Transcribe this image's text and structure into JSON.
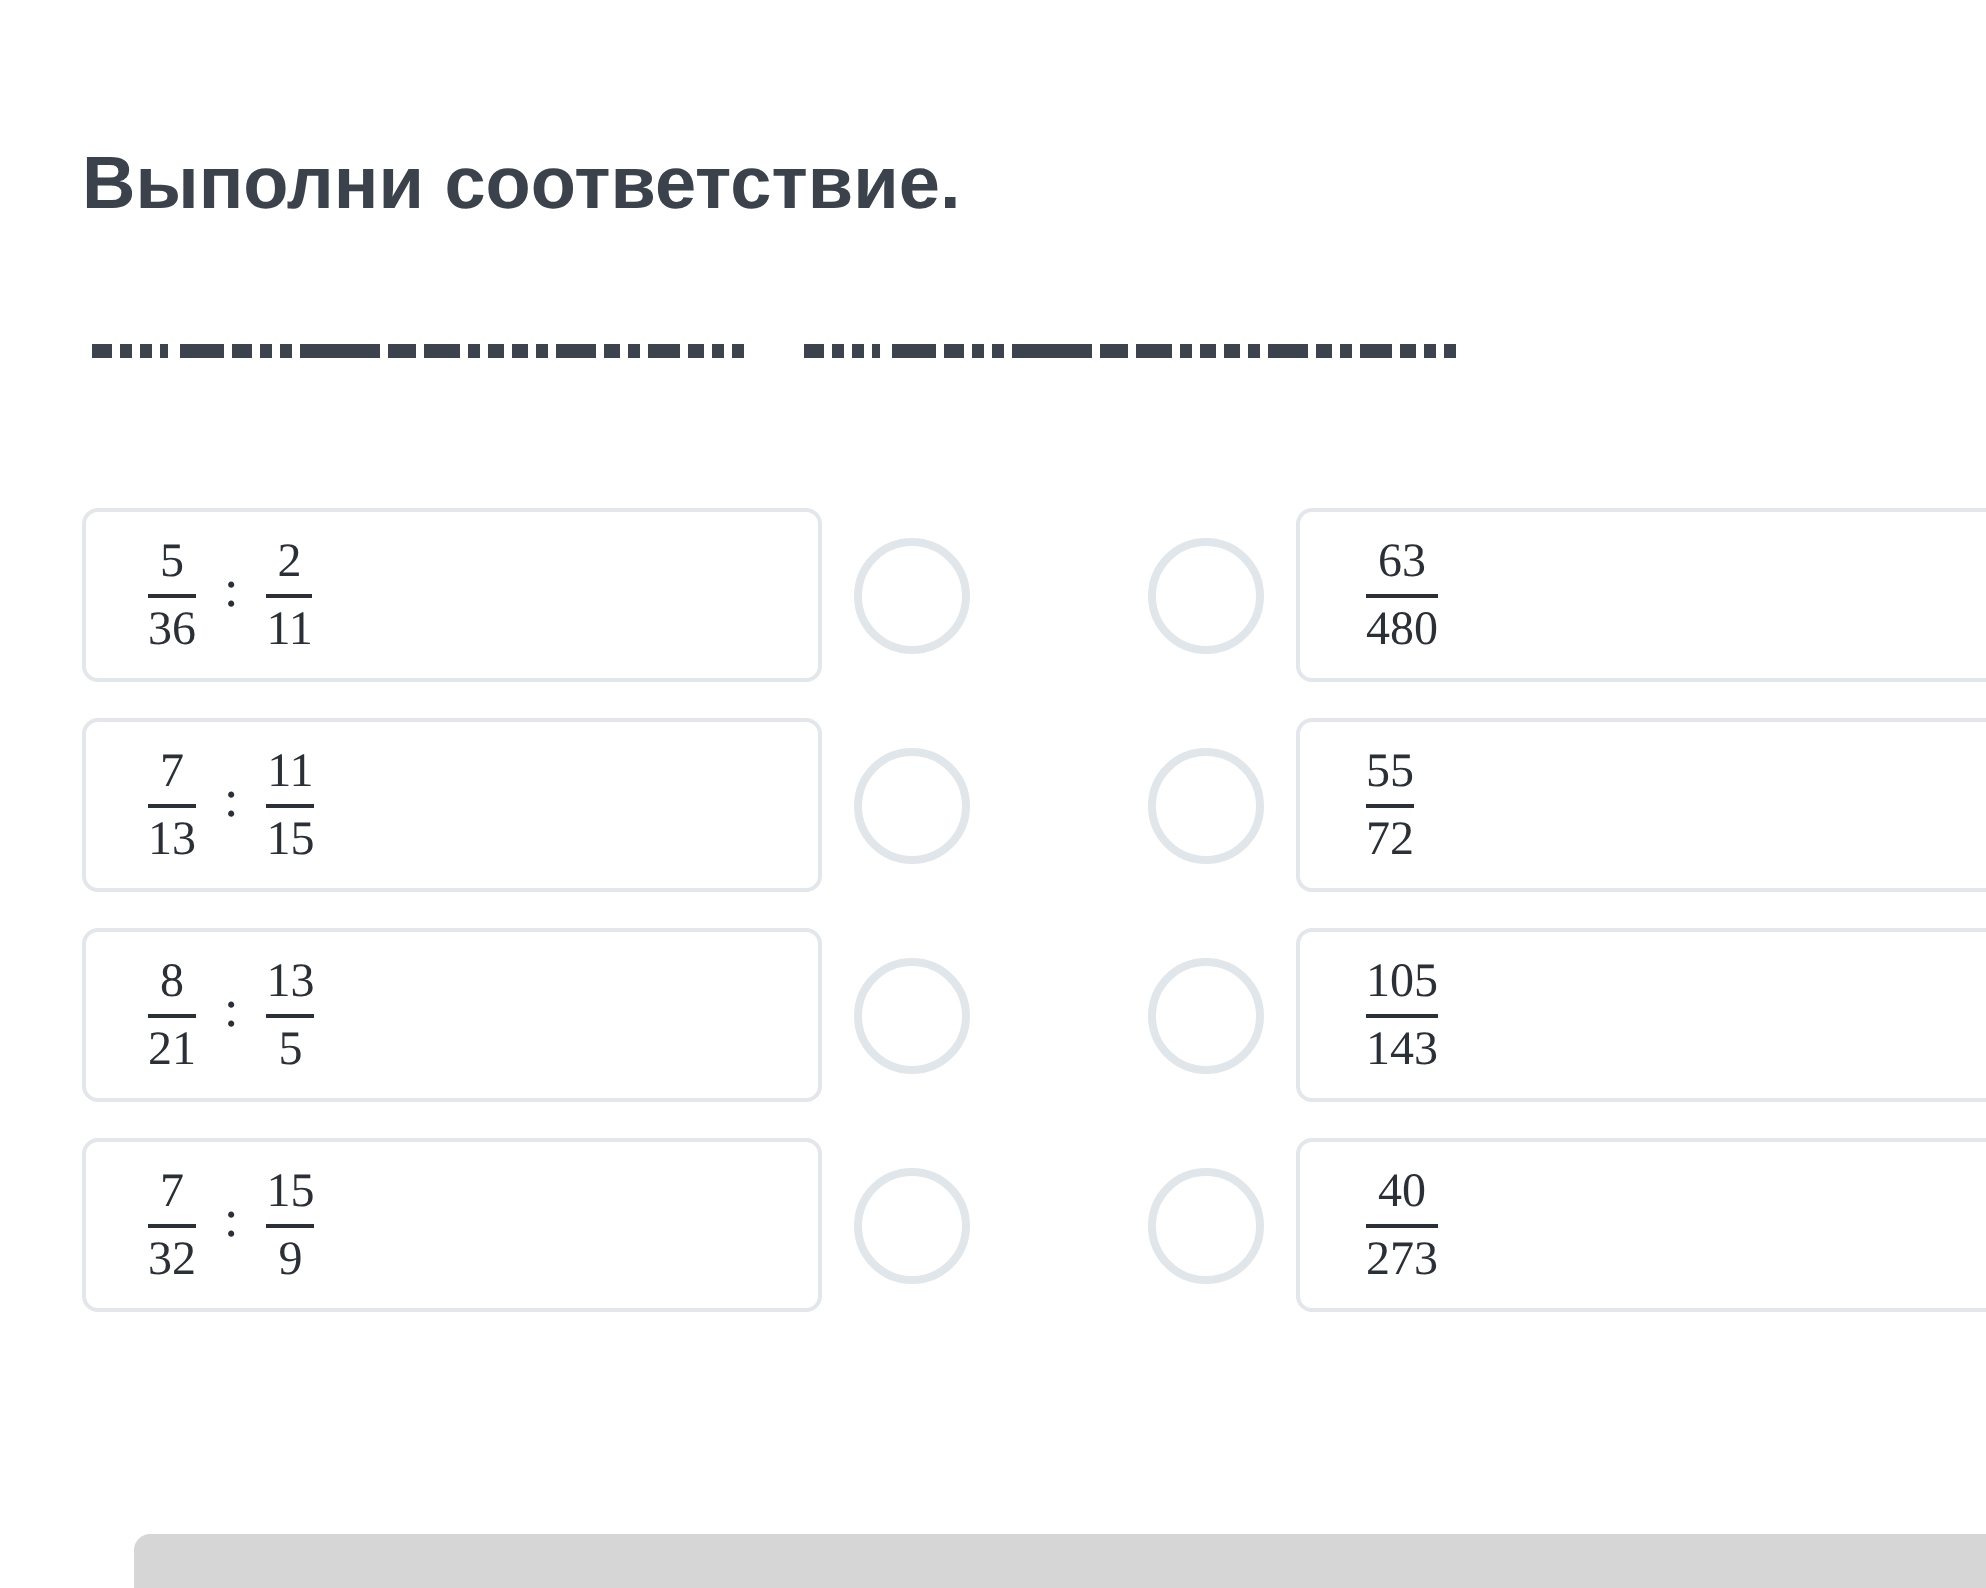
{
  "title": "Выполни соответствие.",
  "left_items": [
    {
      "a": {
        "num": "5",
        "den": "36"
      },
      "op": ":",
      "b": {
        "num": "2",
        "den": "11"
      },
      "selected": false
    },
    {
      "a": {
        "num": "7",
        "den": "13"
      },
      "op": ":",
      "b": {
        "num": "11",
        "den": "15"
      },
      "selected": false
    },
    {
      "a": {
        "num": "8",
        "den": "21"
      },
      "op": ":",
      "b": {
        "num": "13",
        "den": "5"
      },
      "selected": false
    },
    {
      "a": {
        "num": "7",
        "den": "32"
      },
      "op": ":",
      "b": {
        "num": "15",
        "den": "9"
      },
      "selected": false
    }
  ],
  "right_items": [
    {
      "num": "63",
      "den": "480",
      "selected": false
    },
    {
      "num": "55",
      "den": "72",
      "selected": false
    },
    {
      "num": "105",
      "den": "143",
      "selected": false
    },
    {
      "num": "40",
      "den": "273",
      "selected": false
    }
  ]
}
